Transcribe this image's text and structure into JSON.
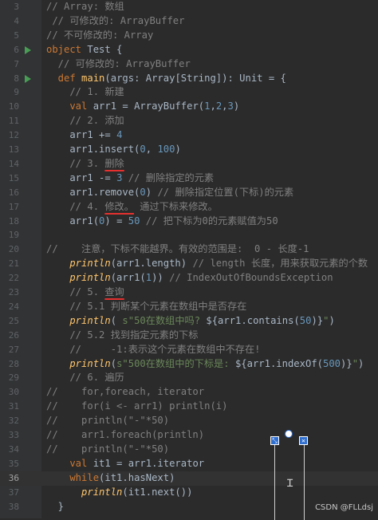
{
  "lines": [
    {
      "n": "3",
      "parts": [
        [
          "cmt",
          "// Array: 数组"
        ]
      ]
    },
    {
      "n": "4",
      "parts": [
        [
          "cmt",
          " // 可修改的: ArrayBuffer"
        ]
      ]
    },
    {
      "n": "5",
      "parts": [
        [
          "cmt",
          "// 不可修改的: Array"
        ]
      ]
    },
    {
      "n": "6",
      "run": true,
      "parts": [
        [
          "kw",
          "object "
        ],
        [
          "t",
          "Test {"
        ]
      ]
    },
    {
      "n": "7",
      "parts": [
        [
          "cmt",
          "  // 可修改的: ArrayBuffer"
        ]
      ]
    },
    {
      "n": "8",
      "run": true,
      "parts": [
        [
          "kw",
          "  def "
        ],
        [
          "fn",
          "main"
        ],
        [
          "t",
          "(args: Array[String]): Unit = {"
        ]
      ]
    },
    {
      "n": "9",
      "parts": [
        [
          "cmt",
          "    // 1. 新建"
        ]
      ]
    },
    {
      "n": "10",
      "parts": [
        [
          "kw",
          "    val "
        ],
        [
          "t",
          "arr1 = ArrayBuffer("
        ],
        [
          "num",
          "1"
        ],
        [
          "t",
          ","
        ],
        [
          "num",
          "2"
        ],
        [
          "t",
          ","
        ],
        [
          "num",
          "3"
        ],
        [
          "t",
          ")"
        ]
      ]
    },
    {
      "n": "11",
      "parts": [
        [
          "cmt",
          "    // 2. 添加"
        ]
      ]
    },
    {
      "n": "12",
      "parts": [
        [
          "t",
          "    arr1 += "
        ],
        [
          "num",
          "4"
        ]
      ]
    },
    {
      "n": "13",
      "parts": [
        [
          "t",
          "    arr1.insert("
        ],
        [
          "num",
          "0"
        ],
        [
          "t",
          ", "
        ],
        [
          "num",
          "100"
        ],
        [
          "t",
          ")"
        ]
      ]
    },
    {
      "n": "14",
      "parts": [
        [
          "cmt",
          "    // 3. "
        ],
        [
          "cmtu",
          "删除"
        ]
      ]
    },
    {
      "n": "15",
      "parts": [
        [
          "t",
          "    arr1 -= "
        ],
        [
          "num",
          "3"
        ],
        [
          "cmt",
          " // 删除指定的元素"
        ]
      ]
    },
    {
      "n": "16",
      "parts": [
        [
          "t",
          "    arr1.remove("
        ],
        [
          "num",
          "0"
        ],
        [
          "t",
          ") "
        ],
        [
          "cmt",
          "// 删除指定位置(下标)的元素"
        ]
      ]
    },
    {
      "n": "17",
      "parts": [
        [
          "cmt",
          "    // 4. "
        ],
        [
          "cmtu",
          "修改。"
        ],
        [
          "cmt",
          " 通过下标来修改。"
        ]
      ]
    },
    {
      "n": "18",
      "parts": [
        [
          "t",
          "    arr1("
        ],
        [
          "num",
          "0"
        ],
        [
          "t",
          ") = "
        ],
        [
          "num",
          "50"
        ],
        [
          "cmt",
          " // 把下标为0的元素赋值为50"
        ]
      ]
    },
    {
      "n": "19",
      "parts": [
        [
          "t",
          ""
        ]
      ]
    },
    {
      "n": "20",
      "parts": [
        [
          "cmt",
          "//    注意，下标不能越界。有效的范围是:  0 - 长度-1"
        ]
      ]
    },
    {
      "n": "21",
      "parts": [
        [
          "fni",
          "    println"
        ],
        [
          "t",
          "(arr1.length) "
        ],
        [
          "cmt",
          "// length 长度，用来获取元素的个数"
        ]
      ]
    },
    {
      "n": "22",
      "parts": [
        [
          "fni",
          "    println"
        ],
        [
          "t",
          "(arr1("
        ],
        [
          "num",
          "1"
        ],
        [
          "t",
          ")) "
        ],
        [
          "cmt",
          "// IndexOutOfBoundsException"
        ]
      ]
    },
    {
      "n": "23",
      "parts": [
        [
          "cmt",
          "    // 5. "
        ],
        [
          "cmtu",
          "查询"
        ]
      ]
    },
    {
      "n": "24",
      "parts": [
        [
          "cmt",
          "    // 5.1 判断某个元素在数组中是否存在"
        ]
      ]
    },
    {
      "n": "25",
      "parts": [
        [
          "fni",
          "    println"
        ],
        [
          "t",
          "( "
        ],
        [
          "str",
          "s\"50在数组中吗? "
        ],
        [
          "t",
          "${arr1.contains("
        ],
        [
          "num",
          "50"
        ],
        [
          "t",
          ")}"
        ],
        [
          "str",
          "\""
        ],
        [
          "t",
          ")"
        ]
      ]
    },
    {
      "n": "26",
      "parts": [
        [
          "cmt",
          "    // 5.2 找到指定元素的下标"
        ]
      ]
    },
    {
      "n": "27",
      "parts": [
        [
          "cmt",
          "    //     -1:表示这个元素在数组中不存在!"
        ]
      ]
    },
    {
      "n": "28",
      "parts": [
        [
          "fni",
          "    println"
        ],
        [
          "t",
          "("
        ],
        [
          "str",
          "s\"500在数组中的下标是: "
        ],
        [
          "t",
          "${arr1.indexOf("
        ],
        [
          "num",
          "500"
        ],
        [
          "t",
          ")}"
        ],
        [
          "str",
          "\""
        ],
        [
          "t",
          ")"
        ]
      ]
    },
    {
      "n": "29",
      "parts": [
        [
          "cmt",
          "    // 6. 遍历"
        ]
      ]
    },
    {
      "n": "30",
      "parts": [
        [
          "cmt",
          "//    for,foreach, iterator"
        ]
      ]
    },
    {
      "n": "31",
      "parts": [
        [
          "cmt",
          "//    for(i <- arr1) println(i)"
        ]
      ]
    },
    {
      "n": "32",
      "parts": [
        [
          "cmt",
          "//    println(\"-\"*50)"
        ]
      ]
    },
    {
      "n": "33",
      "parts": [
        [
          "cmt",
          "//    arr1.foreach(println)"
        ]
      ]
    },
    {
      "n": "34",
      "parts": [
        [
          "cmt",
          "//    println(\"-\"*50)"
        ]
      ]
    },
    {
      "n": "35",
      "parts": [
        [
          "kw",
          "    val "
        ],
        [
          "t",
          "it1 = arr1.iterator"
        ]
      ]
    },
    {
      "n": "36",
      "current": true,
      "parts": [
        [
          "kw",
          "    while"
        ],
        [
          "t",
          "(it1.hasNext)"
        ]
      ]
    },
    {
      "n": "37",
      "parts": [
        [
          "fni",
          "      println"
        ],
        [
          "t",
          "(it1.next())"
        ]
      ]
    },
    {
      "n": "38",
      "parts": [
        [
          "t",
          "  }"
        ]
      ]
    }
  ],
  "watermark": "CSDN @FLLdsj",
  "colors": {
    "background": "#2b2b2b",
    "keyword": "#cc7832",
    "comment": "#808080",
    "number": "#6897bb",
    "string": "#6a8759",
    "function": "#ffc66d",
    "underline": "#e5302f"
  }
}
